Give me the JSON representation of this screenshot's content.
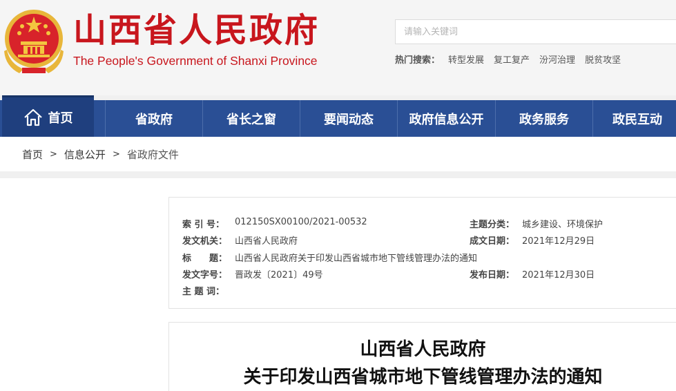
{
  "header": {
    "title": "山西省人民政府",
    "subtitle": "The People's Government of Shanxi Province",
    "emblem_icon": "national-emblem-icon",
    "colors": {
      "brand_red": "#c8161d",
      "emblem_gold": "#e8b63a"
    }
  },
  "search": {
    "placeholder": "请输入关键词",
    "value": "",
    "hot_label": "热门搜索：",
    "hot_terms": [
      "转型发展",
      "复工复产",
      "汾河治理",
      "脱贫攻坚"
    ]
  },
  "nav": {
    "home_icon": "home-icon",
    "colors": {
      "band": "#2a4f95",
      "home": "#1f3f7e"
    },
    "items": [
      {
        "label": "首页"
      },
      {
        "label": "省政府"
      },
      {
        "label": "省长之窗"
      },
      {
        "label": "要闻动态"
      },
      {
        "label": "政府信息公开"
      },
      {
        "label": "政务服务"
      },
      {
        "label": "政民互动"
      }
    ]
  },
  "breadcrumb": {
    "items": [
      "首页",
      "信息公开",
      "省政府文件"
    ],
    "separator": ">"
  },
  "meta": {
    "index_no_label": "索 引 号：",
    "index_no": "012150SX00100/2021-00532",
    "topic_label": "主题分类：",
    "topic": "城乡建设、环境保护",
    "issuer_label": "发文机关：",
    "issuer": "山西省人民政府",
    "created_label": "成文日期：",
    "created": "2021年12月29日",
    "title_label": "标　　题：",
    "title": "山西省人民政府关于印发山西省城市地下管线管理办法的通知",
    "doc_no_label": "发文字号：",
    "doc_no": "晋政发〔2021〕49号",
    "published_label": "发布日期：",
    "published": "2021年12月30日",
    "keywords_label": "主 题 词：",
    "keywords": ""
  },
  "document": {
    "title_line1": "山西省人民政府",
    "title_line2": "关于印发山西省城市地下管线管理办法的通知"
  }
}
